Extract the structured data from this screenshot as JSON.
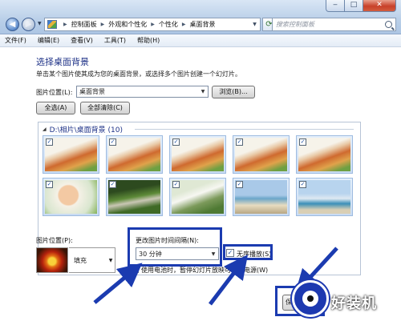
{
  "window": {
    "min_glyph": "‒",
    "max_glyph": "□",
    "close_glyph": "✕",
    "back_glyph": "◀",
    "fwd_glyph": "▶",
    "dropdown_glyph": "▼",
    "refresh_glyph": "⟳"
  },
  "breadcrumbs": [
    "控制面板",
    "外观和个性化",
    "个性化",
    "桌面背景"
  ],
  "breadcrumb_sep": "▶",
  "search": {
    "placeholder": "搜索控制面板"
  },
  "menu": [
    "文件(F)",
    "编辑(E)",
    "查看(V)",
    "工具(T)",
    "帮助(H)"
  ],
  "page": {
    "heading": "选择桌面背景",
    "subtitle": "单击某个图片使其成为您的桌面背景，或选择多个图片创建一个幻灯片。",
    "location_label": "图片位置(L):",
    "location_value": "桌面背景",
    "browse_button": "浏览(B)...",
    "select_all_button": "全选(A)",
    "clear_all_button": "全部清除(C)",
    "folder_title": "D:\\相片\\桌面背景 (10)",
    "folder_collapse_glyph": "◢",
    "check_glyph": "✓",
    "position_label": "图片位置(P):",
    "position_value": "填充",
    "interval_label": "更改图片时间间隔(N):",
    "interval_value": "30 分钟",
    "shuffle_label": "无序播放(S)",
    "battery_label": "使用电池时，暂停幻灯片放映可节省电源(W)",
    "save_button": "保",
    "watermark_text": "好装机"
  },
  "thumbnails": [
    {
      "name": "baby-flowers",
      "checked": true
    },
    {
      "name": "baby-flowers",
      "checked": true
    },
    {
      "name": "baby-flowers",
      "checked": true
    },
    {
      "name": "baby-flowers",
      "checked": true
    },
    {
      "name": "baby-flowers",
      "checked": true
    },
    {
      "name": "baby-portrait",
      "checked": true
    },
    {
      "name": "garden-path",
      "checked": true
    },
    {
      "name": "wedding-couple",
      "checked": true
    },
    {
      "name": "seaside-swing",
      "checked": true
    },
    {
      "name": "beach-jump",
      "checked": true
    }
  ],
  "states": {
    "shuffle_checked": true,
    "battery_checked": false
  },
  "colors": {
    "highlight": "#1b3bb0",
    "heading": "#1e3287"
  },
  "icons": {
    "back": "back-arrow-icon",
    "forward": "forward-arrow-icon",
    "refresh": "refresh-icon",
    "search": "search-icon",
    "address": "control-panel-icon",
    "preview": "flower-preview-icon"
  }
}
